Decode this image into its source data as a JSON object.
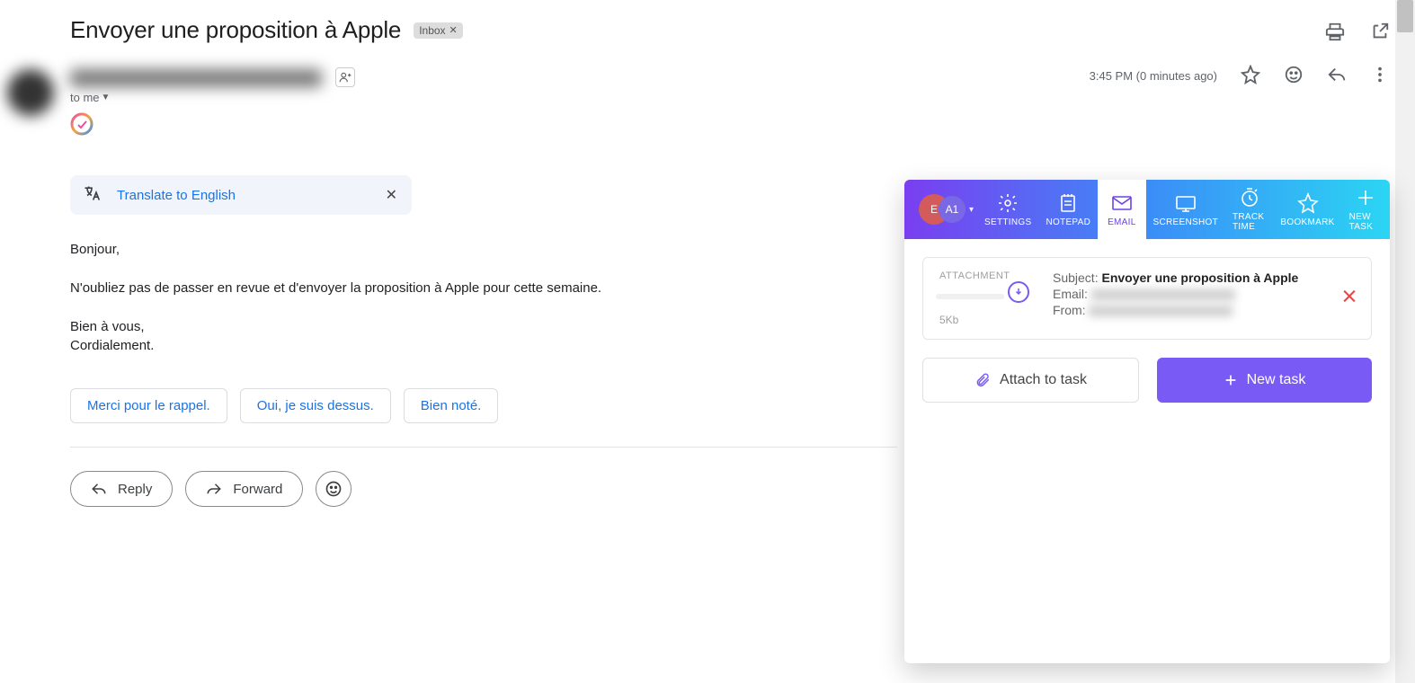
{
  "email": {
    "subject": "Envoyer une proposition à Apple",
    "inbox_chip": "Inbox",
    "to_line": "to me",
    "timestamp": "3:45 PM (0 minutes ago)",
    "translate_label": "Translate to English",
    "body": {
      "greeting": "Bonjour,",
      "line": "N'oubliez pas de passer en revue et d'envoyer la proposition à Apple pour cette semaine.",
      "sign1": "Bien à vous,",
      "sign2": "Cordialement."
    },
    "suggestions": [
      "Merci pour le rappel.",
      "Oui, je suis dessus.",
      "Bien noté."
    ],
    "reply_label": "Reply",
    "forward_label": "Forward"
  },
  "panel": {
    "avatar1": "E",
    "avatar2": "A1",
    "tabs": {
      "settings": "SETTINGS",
      "notepad": "NOTEPAD",
      "email": "EMAIL",
      "screenshot": "SCREENSHOT",
      "tracktime": "TRACK TIME",
      "bookmark": "BOOKMARK",
      "newtask": "NEW TASK"
    },
    "attachment": {
      "label": "ATTACHMENT",
      "subject_key": "Subject:",
      "subject_val": "Envoyer une proposition à Apple",
      "email_key": "Email:",
      "from_key": "From:",
      "size": "5Kb"
    },
    "attach_btn": "Attach to task",
    "newtask_btn": "New task"
  }
}
